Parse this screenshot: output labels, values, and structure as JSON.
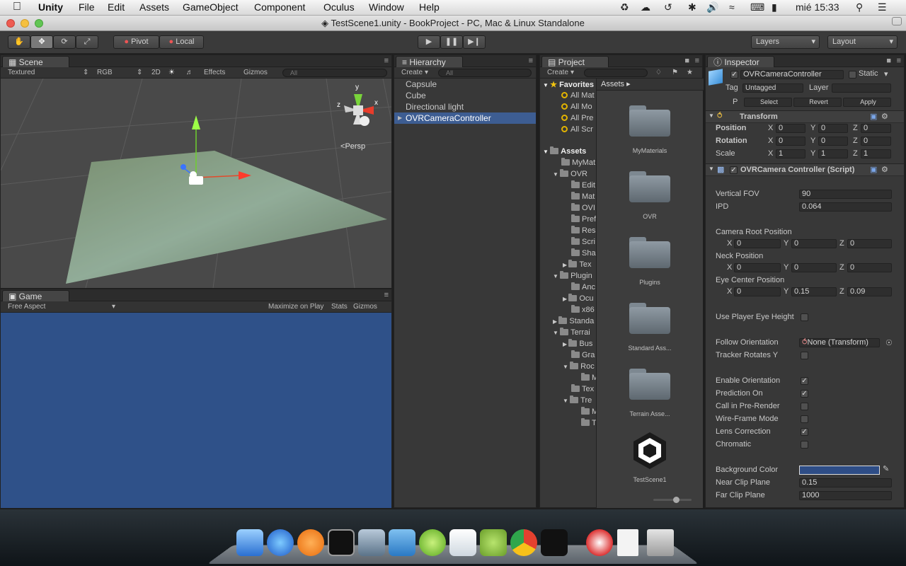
{
  "menubar": {
    "app": "Unity",
    "items": [
      "File",
      "Edit",
      "Assets",
      "GameObject",
      "Component",
      "Oculus",
      "Window",
      "Help"
    ],
    "clock": "mié 15:33"
  },
  "window": {
    "title": "TestScene1.unity - BookProject - PC, Mac & Linux Standalone"
  },
  "toolbar": {
    "pivot": "Pivot",
    "local": "Local",
    "layers": "Layers",
    "layout": "Layout"
  },
  "scene": {
    "tab": "Scene",
    "shading": "Textured",
    "render": "RGB",
    "twod": "2D",
    "effects": "Effects",
    "gizmos": "Gizmos",
    "search_placeholder": "All",
    "persp": "Persp",
    "axis_y": "y",
    "axis_z": "z",
    "axis_x": "x"
  },
  "game": {
    "tab": "Game",
    "aspect": "Free Aspect",
    "maximize": "Maximize on Play",
    "stats": "Stats",
    "gizmos": "Gizmos"
  },
  "hierarchy": {
    "tab": "Hierarchy",
    "create": "Create",
    "search_placeholder": "All",
    "items": [
      "Capsule",
      "Cube",
      "Directional light",
      "OVRCameraController"
    ]
  },
  "project": {
    "tab": "Project",
    "create": "Create",
    "favorites": "Favorites",
    "fav_items": [
      "All Mat",
      "All Mo",
      "All Pre",
      "All Scr"
    ],
    "assets_root": "Assets",
    "tree": [
      "MyMat",
      "OVR",
      "Edit",
      "Mat",
      "OVI",
      "Pref",
      "Res",
      "Scri",
      "Sha",
      "Tex",
      "Plugin",
      "Anc",
      "Ocu",
      "x86",
      "Standa",
      "Terrai",
      "Bus",
      "Gra",
      "Roc",
      "M",
      "Tex",
      "Tre",
      "M",
      "T"
    ],
    "breadcrumb": "Assets",
    "grid": [
      "MyMaterials",
      "OVR",
      "Plugins",
      "Standard Ass...",
      "Terrain Asse...",
      "TestScene1"
    ]
  },
  "inspector": {
    "tab": "Inspector",
    "object_name": "OVRCameraController",
    "static": "Static",
    "tag_label": "Tag",
    "tag_value": "Untagged",
    "layer_label": "Layer",
    "prefab_p": "P",
    "select": "Select",
    "revert": "Revert",
    "apply": "Apply",
    "transform": {
      "title": "Transform",
      "position": "Position",
      "rotation": "Rotation",
      "scale": "Scale",
      "pos": [
        "0",
        "0",
        "0"
      ],
      "rot": [
        "0",
        "0",
        "0"
      ],
      "scl": [
        "1",
        "1",
        "1"
      ],
      "x": "X",
      "y": "Y",
      "z": "Z"
    },
    "script": {
      "title": "OVRCamera Controller (Script)",
      "vfov_label": "Vertical FOV",
      "vfov": "90",
      "ipd_label": "IPD",
      "ipd": "0.064",
      "root_label": "Camera Root Position",
      "root": [
        "0",
        "0",
        "0"
      ],
      "neck_label": "Neck Position",
      "neck": [
        "0",
        "0",
        "0"
      ],
      "eye_label": "Eye Center Position",
      "eye": [
        "0",
        "0.15",
        "0.09"
      ],
      "use_eye_height": "Use Player Eye Height",
      "follow_label": "Follow Orientation",
      "follow_value": "None (Transform)",
      "tracker": "Tracker Rotates Y",
      "enable_orient": "Enable Orientation",
      "prediction": "Prediction On",
      "call_prerender": "Call in Pre-Render",
      "wireframe": "Wire-Frame Mode",
      "lens": "Lens Correction",
      "chromatic": "Chromatic",
      "bg_label": "Background Color",
      "near_label": "Near Clip Plane",
      "near": "0.15",
      "far_label": "Far Clip Plane",
      "far": "1000"
    }
  },
  "colors": {
    "selection": "#3d5d92",
    "game_bg": "#2f5189",
    "background_color": "#2e4d86"
  }
}
